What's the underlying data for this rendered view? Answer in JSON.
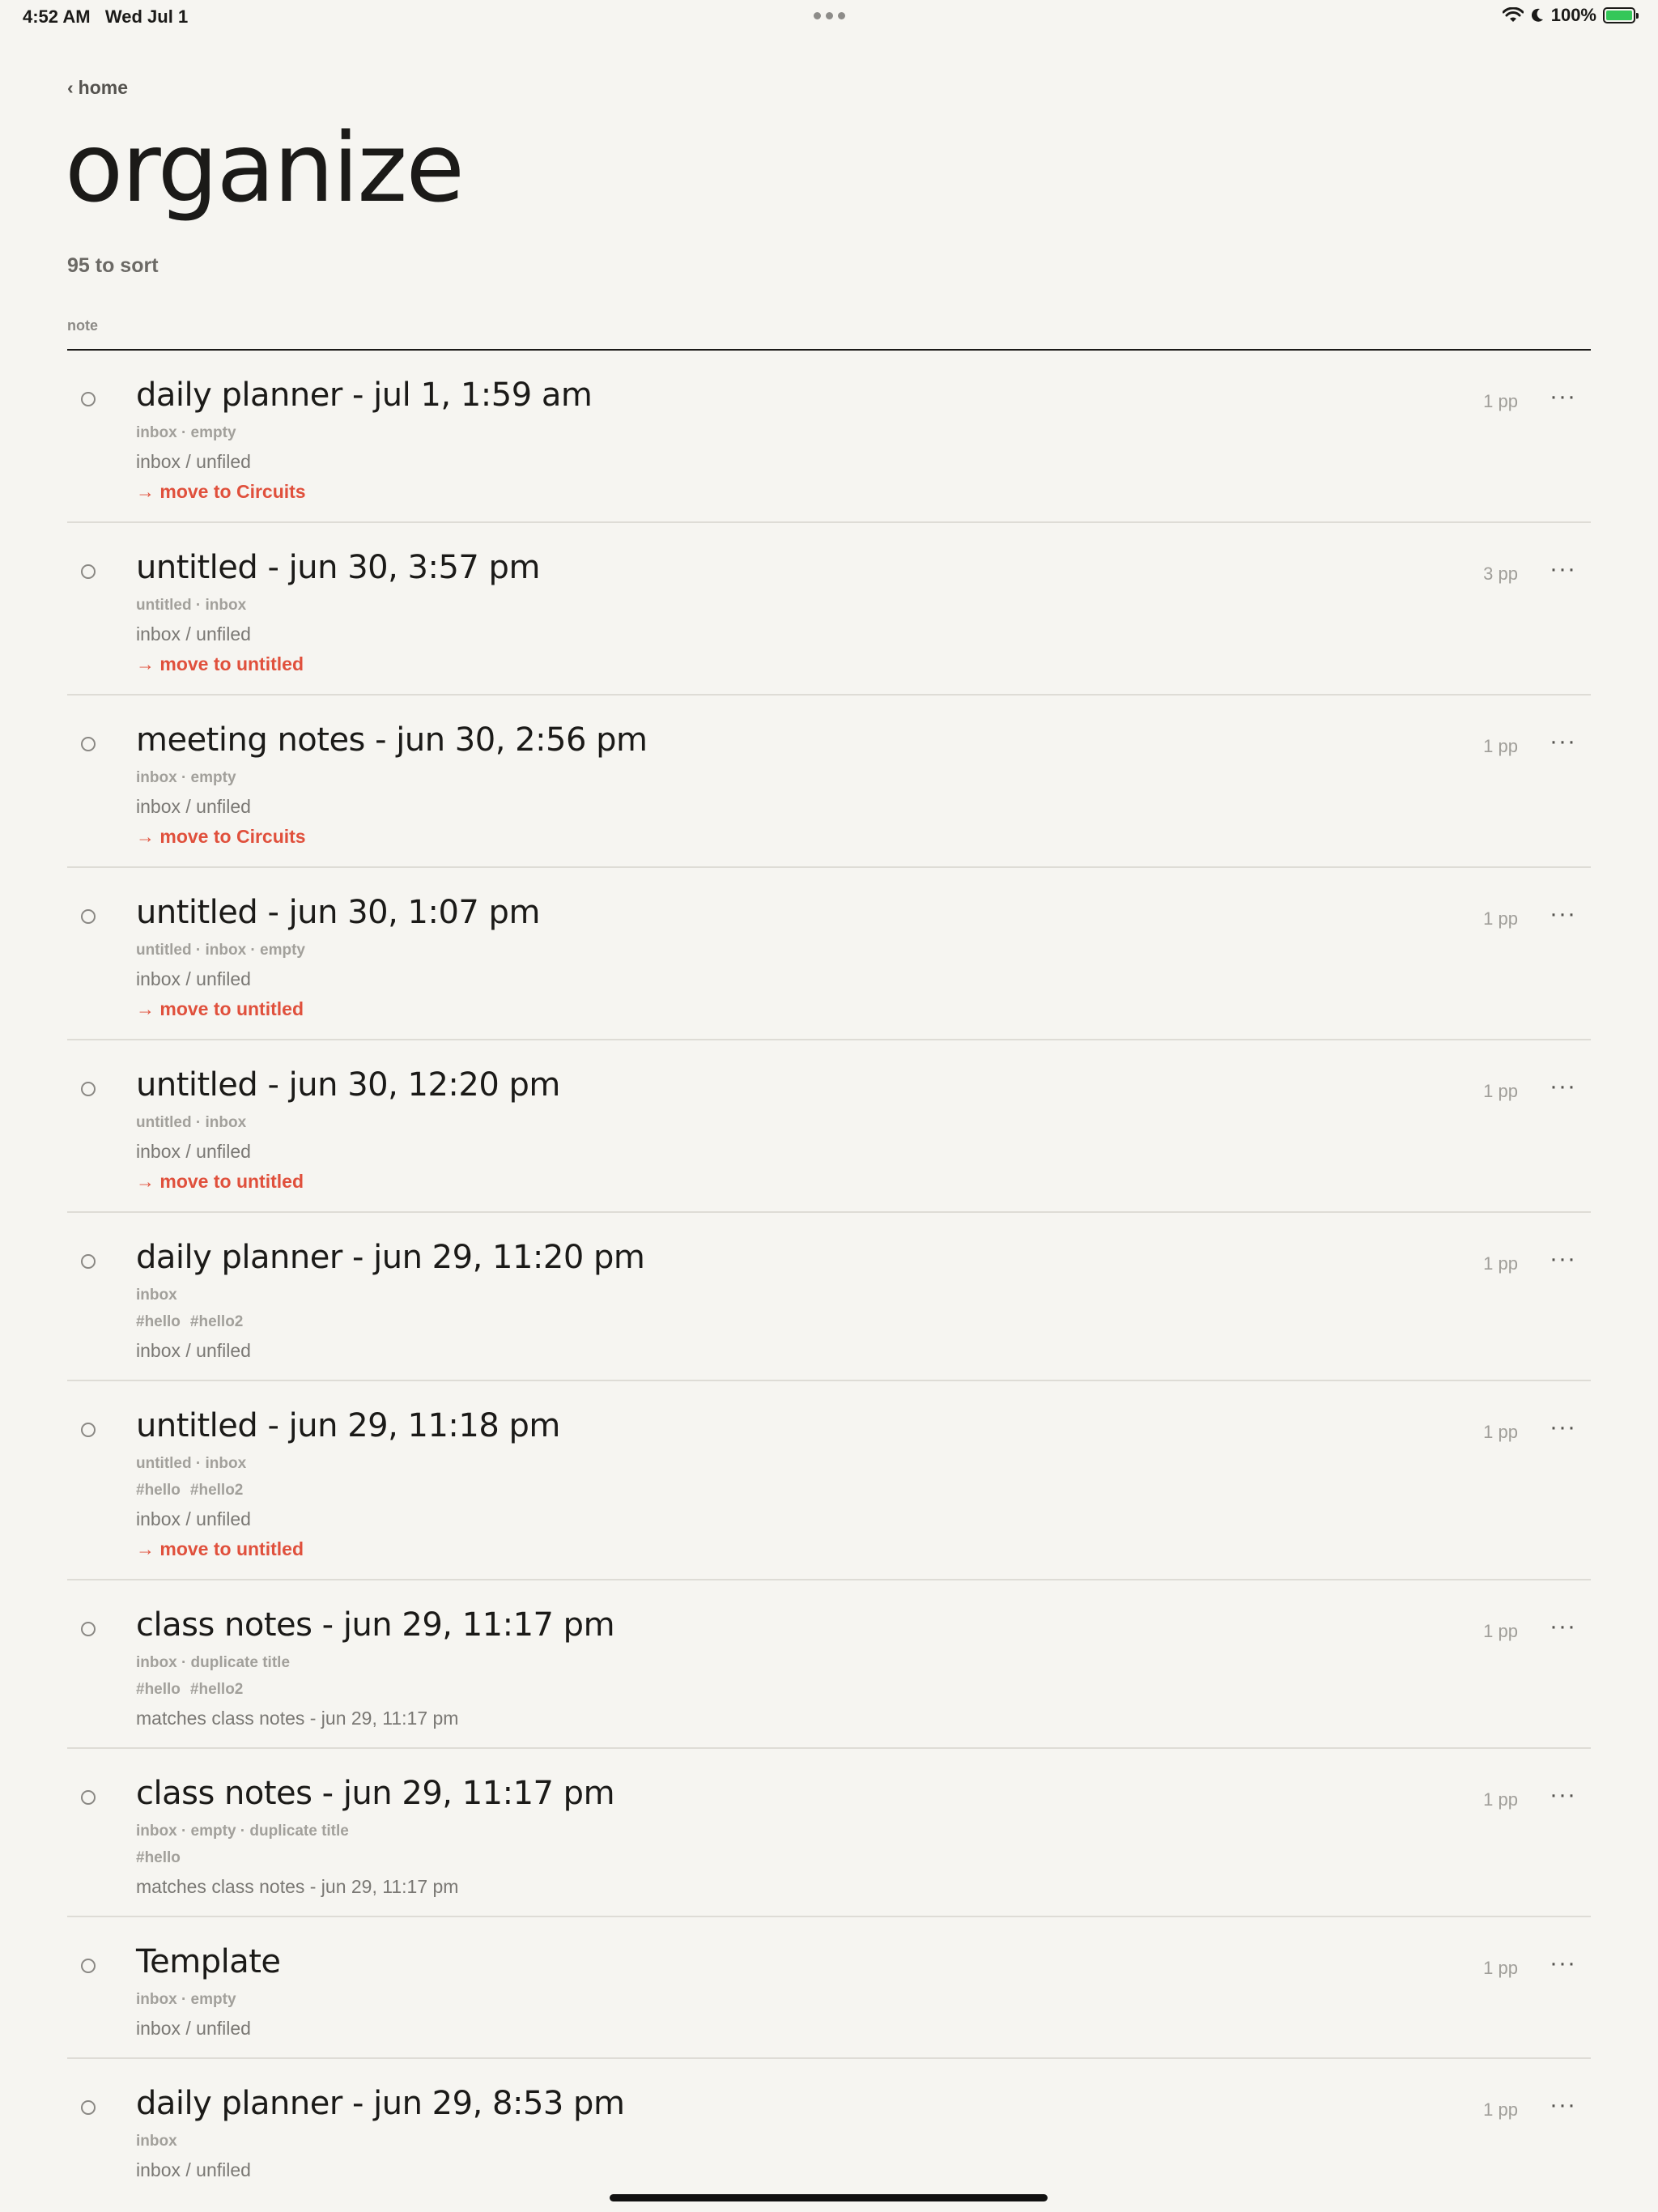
{
  "status_bar": {
    "time": "4:52 AM",
    "date": "Wed Jul 1",
    "battery": "100%"
  },
  "nav": {
    "back_label": "home"
  },
  "page": {
    "title": "organize",
    "subtitle": "95 to sort",
    "column_header": "note"
  },
  "notes": [
    {
      "title": "daily planner - jul 1, 1:59 am",
      "meta": "inbox · empty",
      "location": "inbox / unfiled",
      "action": "move to Circuits",
      "pages": "1 pp"
    },
    {
      "title": "untitled - jun 30, 3:57 pm",
      "meta": "untitled · inbox",
      "location": "inbox / unfiled",
      "action": "move to untitled",
      "pages": "3 pp"
    },
    {
      "title": "meeting notes - jun 30, 2:56 pm",
      "meta": "inbox · empty",
      "location": "inbox / unfiled",
      "action": "move to Circuits",
      "pages": "1 pp"
    },
    {
      "title": "untitled - jun 30, 1:07 pm",
      "meta": "untitled · inbox · empty",
      "location": "inbox / unfiled",
      "action": "move to untitled",
      "pages": "1 pp"
    },
    {
      "title": "untitled - jun 30, 12:20 pm",
      "meta": "untitled · inbox",
      "location": "inbox / unfiled",
      "action": "move to untitled",
      "pages": "1 pp"
    },
    {
      "title": "daily planner - jun 29, 11:20 pm",
      "meta": "inbox",
      "tags": [
        "#hello",
        "#hello2"
      ],
      "location": "inbox / unfiled",
      "pages": "1 pp"
    },
    {
      "title": "untitled - jun 29, 11:18 pm",
      "meta": "untitled · inbox",
      "tags": [
        "#hello",
        "#hello2"
      ],
      "location": "inbox / unfiled",
      "action": "move to untitled",
      "pages": "1 pp"
    },
    {
      "title": "class notes - jun 29, 11:17 pm",
      "meta": "inbox · duplicate title",
      "tags": [
        "#hello",
        "#hello2"
      ],
      "location": "matches class notes - jun 29, 11:17 pm",
      "pages": "1 pp"
    },
    {
      "title": "class notes - jun 29, 11:17 pm",
      "meta": "inbox · empty · duplicate title",
      "tags": [
        "#hello"
      ],
      "location": "matches class notes - jun 29, 11:17 pm",
      "pages": "1 pp"
    },
    {
      "title": "Template",
      "meta": "inbox · empty",
      "location": "inbox / unfiled",
      "pages": "1 pp"
    },
    {
      "title": "daily planner - jun 29, 8:53 pm",
      "meta": "inbox",
      "location": "inbox / unfiled",
      "pages": "1 pp"
    }
  ]
}
